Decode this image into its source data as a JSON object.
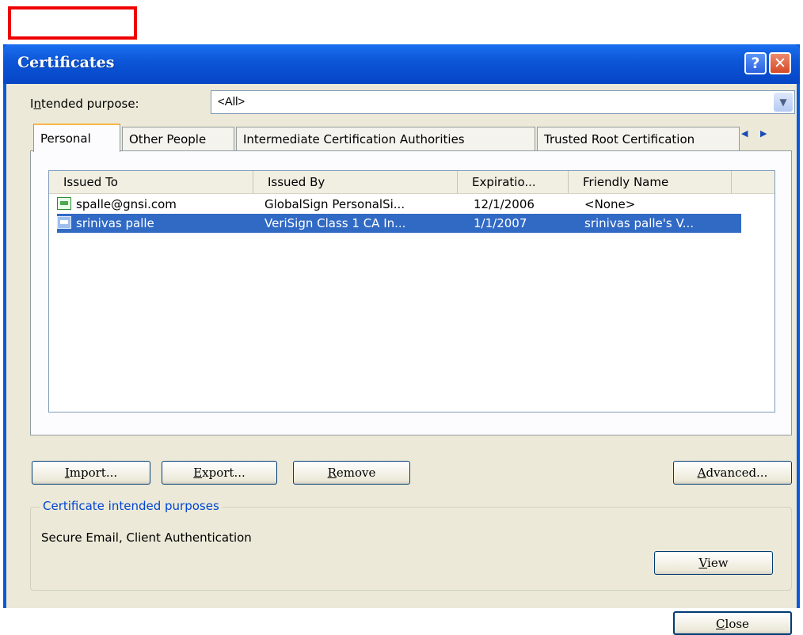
{
  "window": {
    "title": "Certificates"
  },
  "titlebar": {
    "help_glyph": "?",
    "close_glyph": "✕"
  },
  "purpose": {
    "label_prefix": "I",
    "label_mnemonic": "n",
    "label_suffix": "tended purpose:",
    "selected": "<All>"
  },
  "tabs": [
    {
      "label": "Personal"
    },
    {
      "label": "Other People"
    },
    {
      "label": "Intermediate Certification Authorities"
    },
    {
      "label": "Trusted Root Certification"
    }
  ],
  "tab_scroll": {
    "glyphs": "◀ ▶"
  },
  "list": {
    "columns": [
      "Issued To",
      "Issued By",
      "Expiratio...",
      "Friendly Name"
    ],
    "rows": [
      {
        "issued_to": "spalle@gnsi.com",
        "issued_by": "GlobalSign PersonalSi...",
        "expiration": "12/1/2006",
        "friendly_name": "<None>"
      },
      {
        "issued_to": "srinivas palle",
        "issued_by": "VeriSign Class 1 CA In...",
        "expiration": "1/1/2007",
        "friendly_name": "srinivas palle's V..."
      }
    ]
  },
  "buttons": {
    "import": {
      "mnemonic": "I",
      "rest": "mport..."
    },
    "export": {
      "mnemonic": "E",
      "rest": "xport..."
    },
    "remove": {
      "mnemonic": "R",
      "rest": "emove"
    },
    "advanced": {
      "mnemonic": "A",
      "rest": "dvanced..."
    },
    "view": {
      "mnemonic": "V",
      "rest": "iew"
    },
    "close": {
      "mnemonic": "C",
      "rest": "lose"
    }
  },
  "purposes_group": {
    "legend": "Certificate intended purposes",
    "text": "Secure Email, Client Authentication"
  },
  "colors": {
    "selection": "#316ac5",
    "titlebar": "#0b55d6",
    "dialog_bg": "#ece9d8",
    "annotation": "#ee0000"
  }
}
